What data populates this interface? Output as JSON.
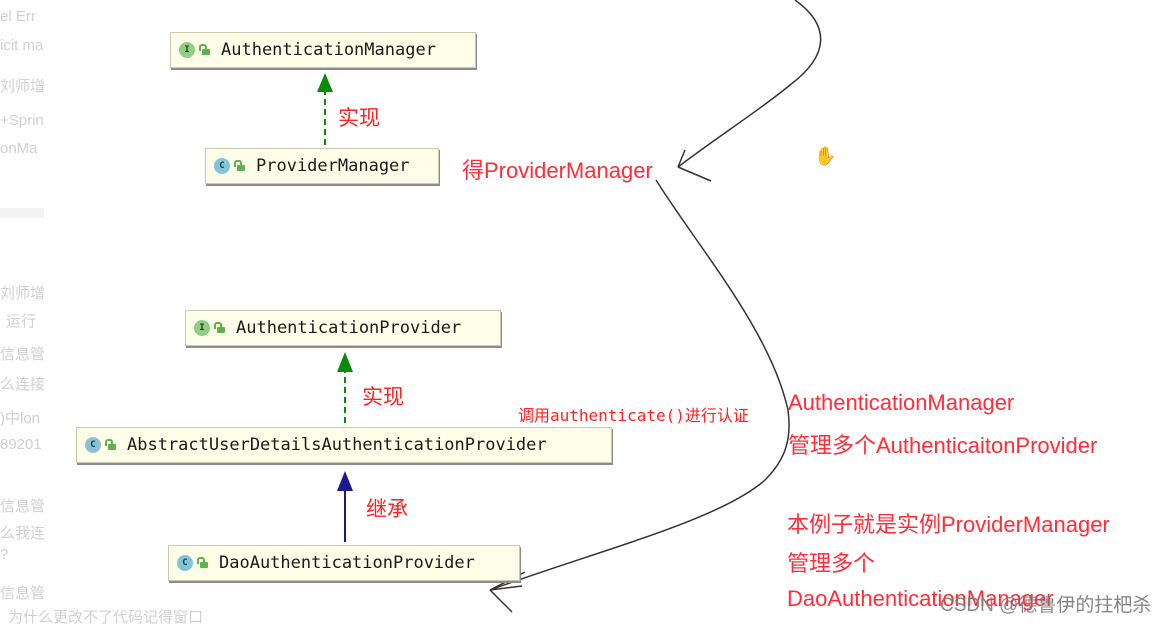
{
  "background_page": {
    "lines": [
      "el Err",
      "icit ma",
      "刘师增",
      "+Sprin",
      "onMa",
      "刘师增",
      "运行",
      "信息管",
      "么连接",
      ")中lon",
      "89201",
      "信息管",
      "么我连",
      "?",
      "信息管"
    ],
    "bottom_text": "为什么更改不了代码记得窗口"
  },
  "diagram": {
    "nodes": [
      {
        "kind": "interface",
        "badge": "I",
        "name": "AuthenticationManager"
      },
      {
        "kind": "class",
        "badge": "C",
        "name": "ProviderManager"
      },
      {
        "kind": "interface",
        "badge": "I",
        "name": "AuthenticationProvider"
      },
      {
        "kind": "abstract-class",
        "badge": "C",
        "name": "AbstractUserDetailsAuthenticationProvider"
      },
      {
        "kind": "class",
        "badge": "C",
        "name": "DaoAuthenticationProvider"
      }
    ],
    "edges": [
      {
        "from": "ProviderManager",
        "to": "AuthenticationManager",
        "type": "implements",
        "label": "实现",
        "color": "#0a8a0a"
      },
      {
        "from": "AbstractUserDetailsAuthenticationProvider",
        "to": "AuthenticationProvider",
        "type": "implements",
        "label": "实现",
        "color": "#0a8a0a"
      },
      {
        "from": "DaoAuthenticationProvider",
        "to": "AbstractUserDetailsAuthenticationProvider",
        "type": "extends",
        "label": "继承",
        "color": "#1a1a8c"
      }
    ]
  },
  "annotations": {
    "get_provider_manager": "得ProviderManager",
    "call_authenticate": "调用authenticate()进行认证",
    "manager_line1": "AuthenticationManager",
    "manager_line2": "管理多个AuthenticaitonProvider",
    "example_line1": "本例子就是实例ProviderManager",
    "example_line2": "管理多个",
    "example_line3": "DaoAuthenticationManager"
  },
  "watermark": "CSDN @德鲁伊的拄杷杀",
  "colors": {
    "annotation_red": "#ff2d3a",
    "node_bg": "#fefee8",
    "implements_arrow": "#0a8a0a",
    "extends_arrow": "#1a1a8c"
  }
}
